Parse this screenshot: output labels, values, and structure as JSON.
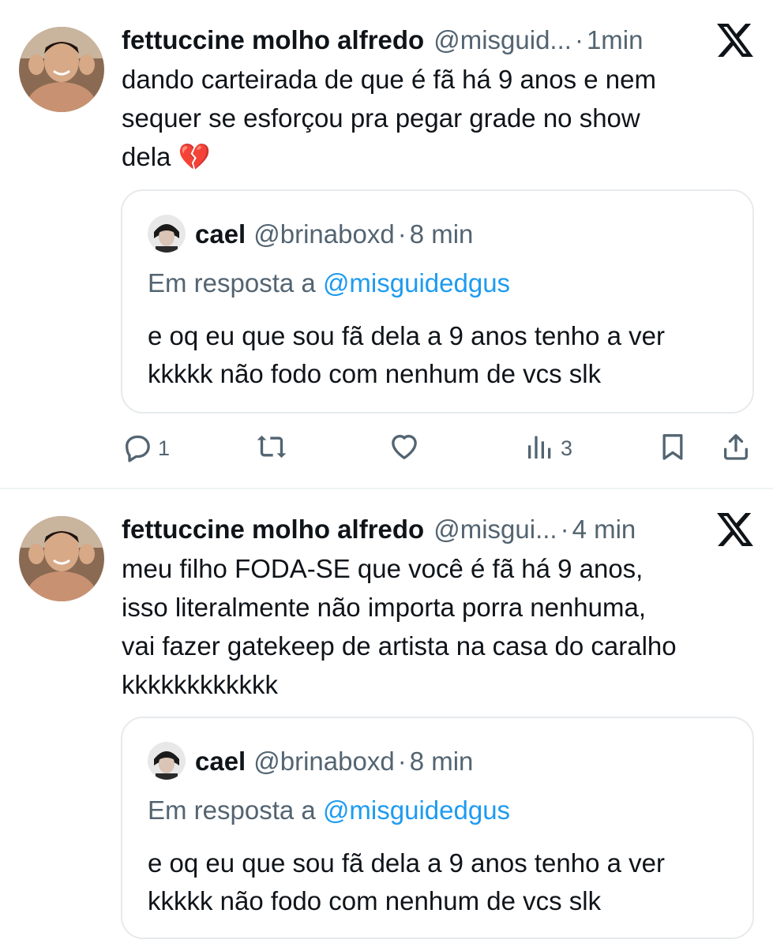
{
  "tweets": [
    {
      "display_name": "fettuccine molho alfredo",
      "handle": "@misguid...",
      "time": "1min",
      "text": "dando carteirada de que é fã há 9 anos e nem\nsequer se esforçou pra pegar grade no show\ndela 💔",
      "quote": {
        "display_name": "cael",
        "handle": "@brinaboxd",
        "time": "8 min",
        "reply_prefix": "Em resposta a",
        "reply_mention": "@misguidedgus",
        "text": "e oq eu que sou fã dela a 9 anos tenho a ver\nkkkkk não fodo com nenhum de vcs slk"
      },
      "actions": {
        "reply_count": "1",
        "repost_count": "",
        "like_count": "",
        "views_count": "3"
      }
    },
    {
      "display_name": "fettuccine molho alfredo",
      "handle": "@misgui...",
      "time": "4 min",
      "text": "meu filho FODA-SE que você é fã há 9 anos,\nisso literalmente não importa porra nenhuma,\nvai fazer gatekeep de artista na casa do caralho\nkkkkkkkkkkkk",
      "quote": {
        "display_name": "cael",
        "handle": "@brinaboxd",
        "time": "8 min",
        "reply_prefix": "Em resposta a",
        "reply_mention": "@misguidedgus",
        "text": "e oq eu que sou fã dela a 9 anos tenho a ver\nkkkkk não fodo com nenhum de vcs slk"
      }
    }
  ],
  "separator_dot": "·",
  "icons": {
    "logo": "x-logo-icon",
    "reply": "reply-icon",
    "repost": "repost-icon",
    "like": "heart-icon",
    "views": "views-icon",
    "bookmark": "bookmark-icon",
    "share": "share-icon"
  },
  "colors": {
    "text": "#0f1419",
    "secondary": "#536471",
    "accent": "#1d9bf0",
    "border": "#e7eaec"
  }
}
